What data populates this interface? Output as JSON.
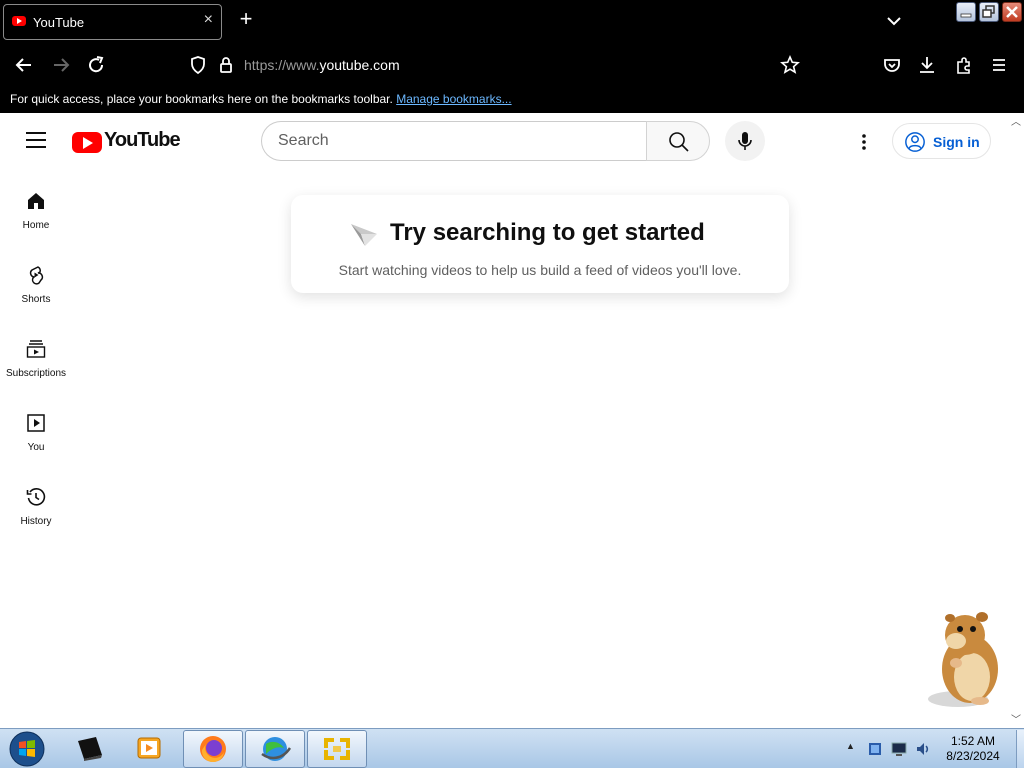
{
  "tab": {
    "title": "YouTube",
    "close": "×",
    "new_tab": "+"
  },
  "address_bar": {
    "url_prefix": "https://www.",
    "url_domain": "youtube.com"
  },
  "bookmarks_bar": {
    "message": "For quick access, place your bookmarks here on the bookmarks toolbar.",
    "link": "Manage bookmarks..."
  },
  "youtube": {
    "logo_text": "YouTube",
    "search_placeholder": "Search",
    "sign_in": "Sign in",
    "sidebar": [
      {
        "label": "Home"
      },
      {
        "label": "Shorts"
      },
      {
        "label": "Subscriptions"
      },
      {
        "label": "You"
      },
      {
        "label": "History"
      }
    ],
    "empty_state": {
      "title": "Try searching to get started",
      "subtitle": "Start watching videos to help us build a feed of videos you'll love."
    }
  },
  "taskbar": {
    "time": "1:52 AM",
    "date": "8/23/2024"
  },
  "colors": {
    "youtube_red": "#ff0000",
    "link_blue": "#065fd4",
    "browser_chrome": "#000000"
  }
}
